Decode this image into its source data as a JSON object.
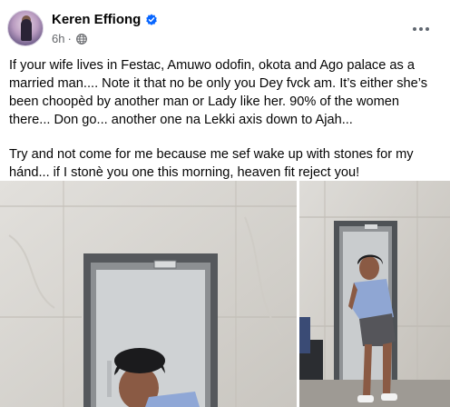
{
  "post": {
    "author_name": "Keren Effiong",
    "time_ago": "6h",
    "separator": "·",
    "icons": {
      "verified": "verified-badge-icon",
      "audience": "globe-icon",
      "more": "more-options-icon"
    },
    "paragraphs": [
      "If your wife lives in Festac, Amuwo odofin, okota and Ago palace as a married man.... Note it that no be only you Dey fvck am. It’s either she’s been choopèd by another man or Lady like her. 90% of the women there... Don go... another one na Lekki axis down to Ajah...",
      "Try and not come for me because me sef wake up with stones for my hánd... if I stonè you one this morning, heaven fit reject you!"
    ],
    "photos": [
      {
        "description_icon": "photo"
      },
      {
        "description_icon": "photo"
      }
    ]
  },
  "colors": {
    "accent": "#0866ff",
    "text": "#050505",
    "secondary_text": "#65676b"
  }
}
